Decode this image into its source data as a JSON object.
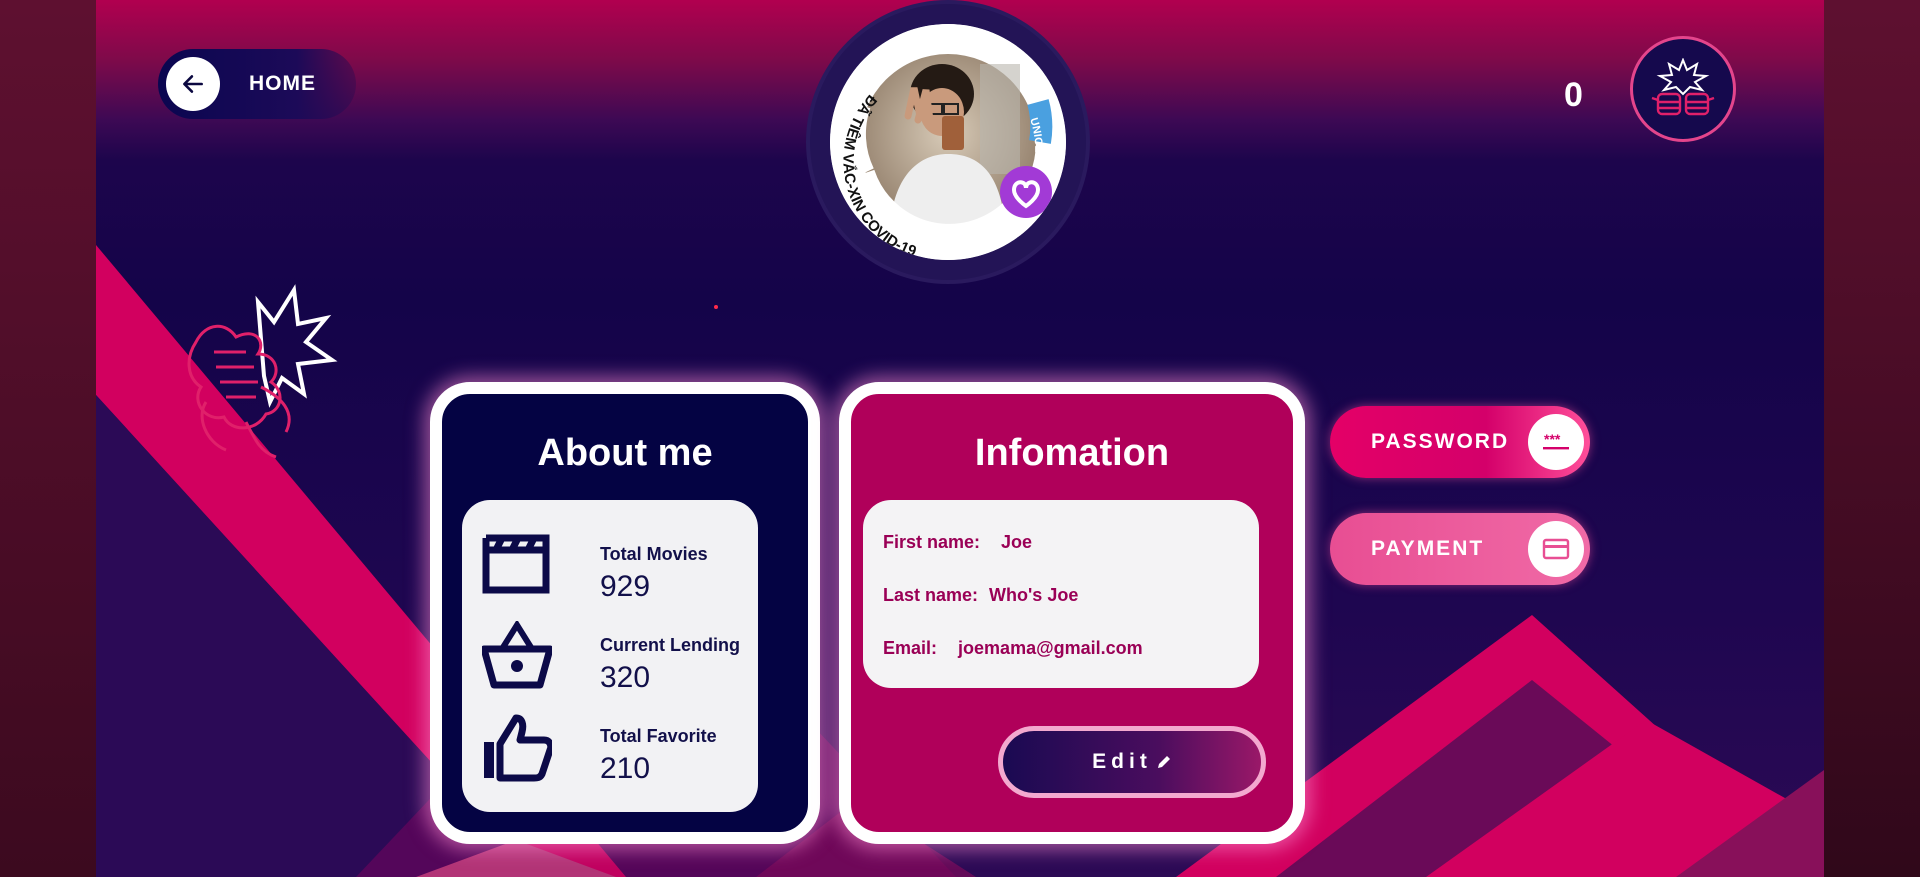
{
  "header": {
    "home_label": "HOME",
    "counter": "0"
  },
  "avatar": {
    "badge_text_left": "ĐÃ TIÊM VẮC-XIN COVID-19",
    "badge_text_right": "UNICEF"
  },
  "about": {
    "title": "About me",
    "stats": [
      {
        "label": "Total Movies",
        "value": "929",
        "icon": "clapperboard-icon"
      },
      {
        "label": "Current Lending",
        "value": "320",
        "icon": "basket-icon"
      },
      {
        "label": "Total Favorite",
        "value": "210",
        "icon": "thumbs-up-icon"
      }
    ]
  },
  "info": {
    "title": "Infomation",
    "first_name_label": "First name:",
    "first_name": "Joe",
    "last_name_label": "Last name:",
    "last_name": "Who's Joe",
    "email_label": "Email:",
    "email": "joemama@gmail.com",
    "edit_label": "Edit"
  },
  "actions": {
    "password_label": "PASSWORD",
    "payment_label": "PAYMENT"
  },
  "colors": {
    "accent_pink": "#e40067",
    "card_navy": "#040343",
    "card_magenta": "#b0005a"
  }
}
